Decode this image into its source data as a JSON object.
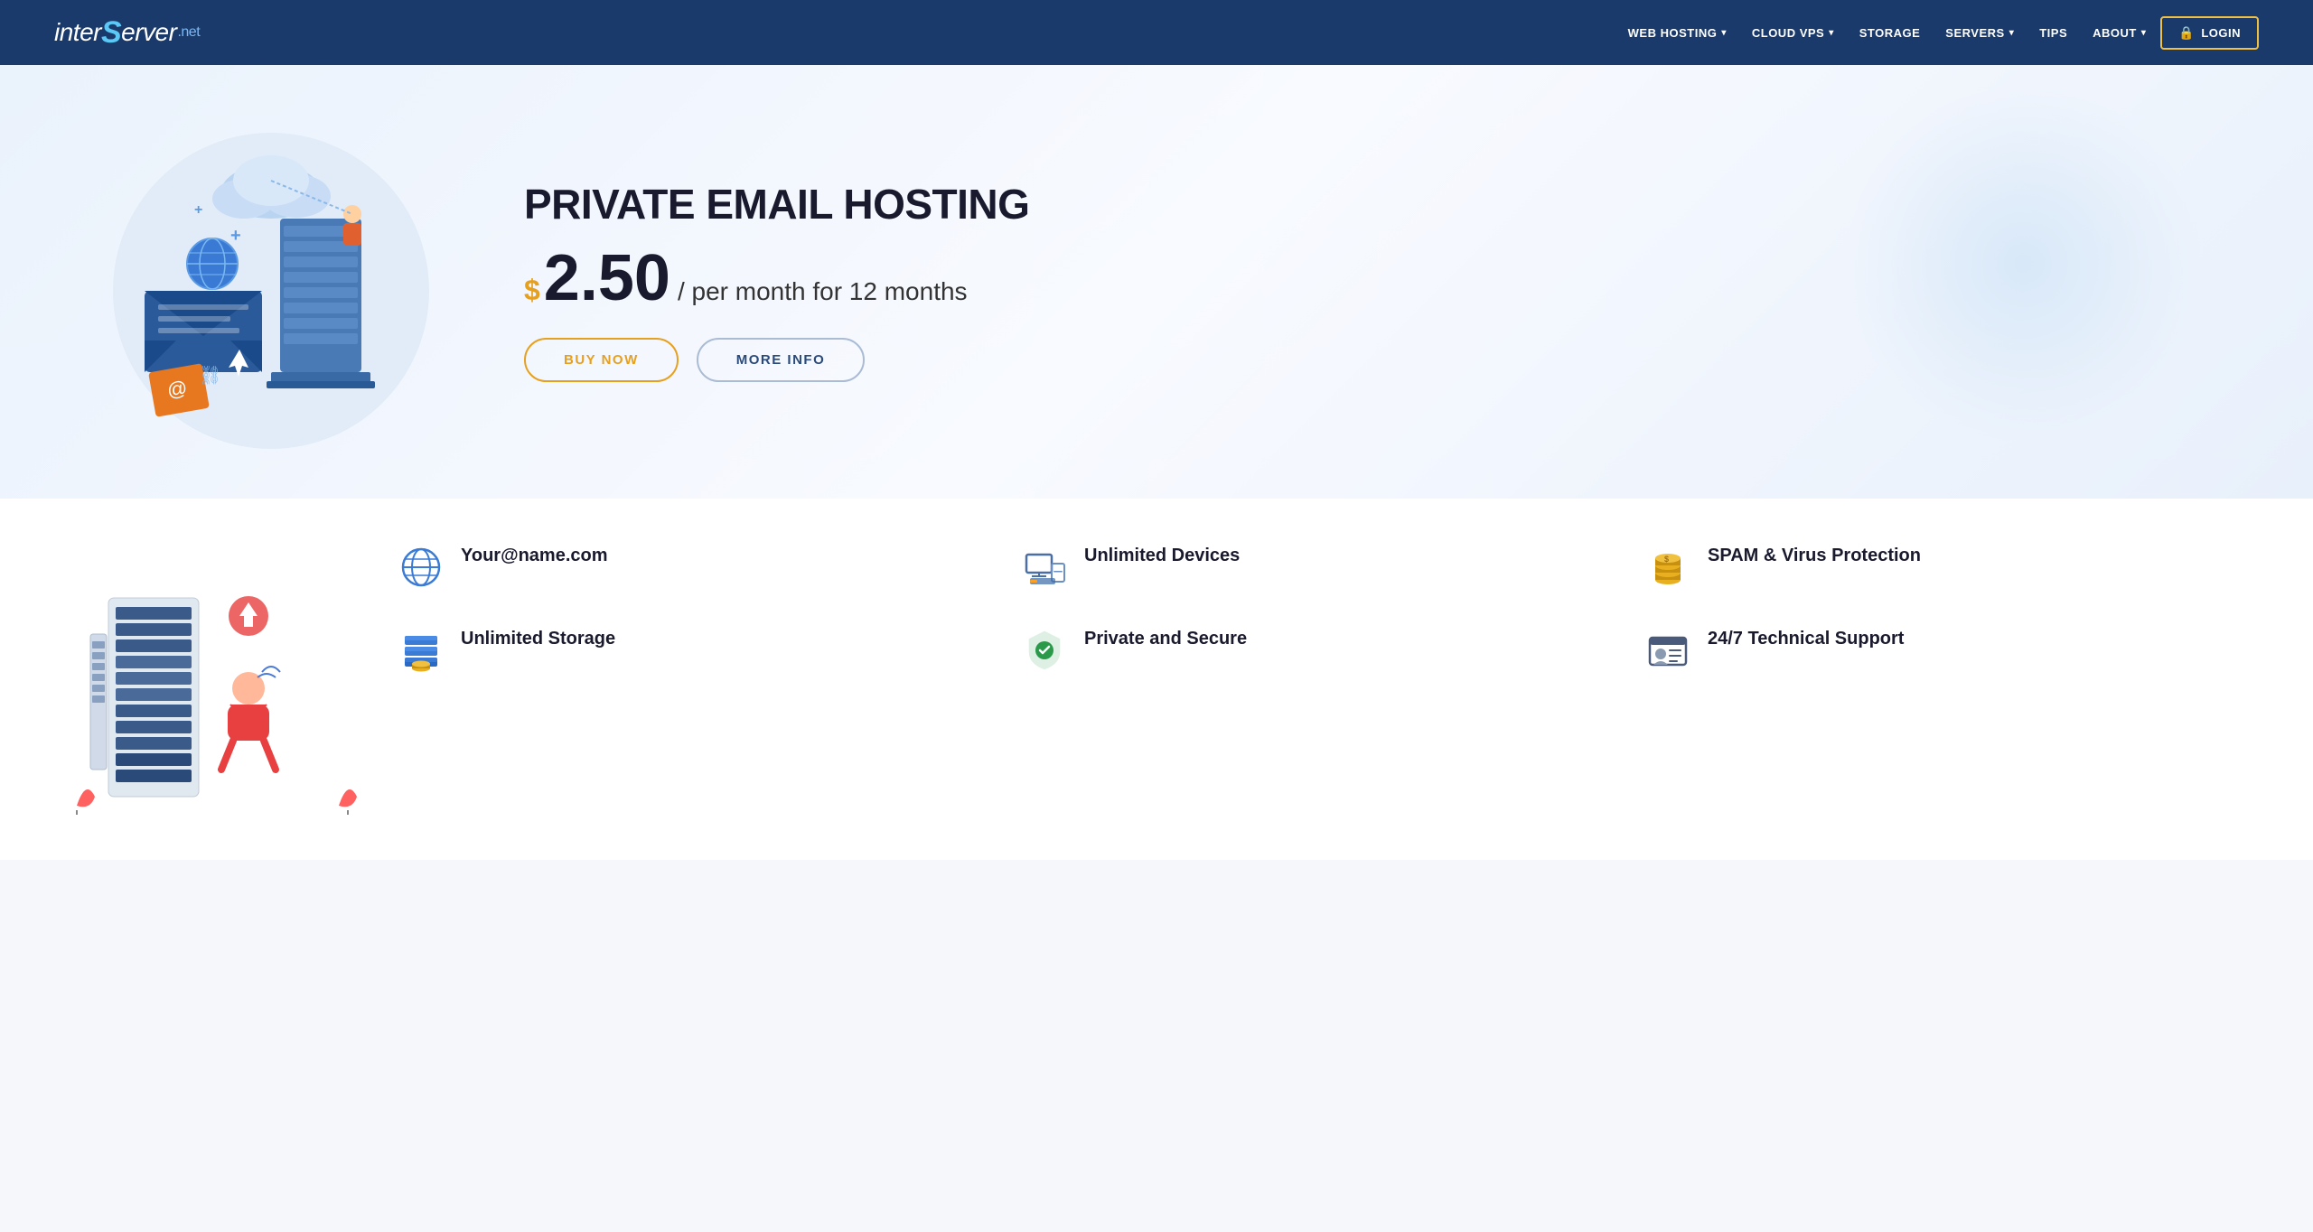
{
  "header": {
    "logo": {
      "inter": "inter",
      "s_curl": "S",
      "erver": "erver",
      "net": ".net"
    },
    "nav": [
      {
        "label": "WEB HOSTING",
        "dropdown": true
      },
      {
        "label": "CLOUD VPS",
        "dropdown": true
      },
      {
        "label": "STORAGE",
        "dropdown": false
      },
      {
        "label": "SERVERS",
        "dropdown": true
      },
      {
        "label": "TIPS",
        "dropdown": false
      },
      {
        "label": "ABOUT",
        "dropdown": true
      }
    ],
    "login_label": "LOGIN"
  },
  "hero": {
    "title": "PRIVATE EMAIL HOSTING",
    "price_dollar": "$",
    "price_amount": "2.50",
    "price_period": "/ per month for 12 months",
    "btn_buy": "BUY NOW",
    "btn_info": "MORE INFO"
  },
  "features": {
    "items": [
      {
        "id": "email",
        "icon": "🌐",
        "label": "Your@name.com"
      },
      {
        "id": "devices",
        "icon": "💻",
        "label": "Unlimited Devices"
      },
      {
        "id": "spam",
        "icon": "🛡️",
        "label": "SPAM & Virus Protection"
      },
      {
        "id": "storage",
        "icon": "📦",
        "label": "Unlimited Storage"
      },
      {
        "id": "secure",
        "icon": "✅",
        "label": "Private and Secure"
      },
      {
        "id": "support",
        "icon": "🎫",
        "label": "24/7 Technical Support"
      }
    ]
  }
}
